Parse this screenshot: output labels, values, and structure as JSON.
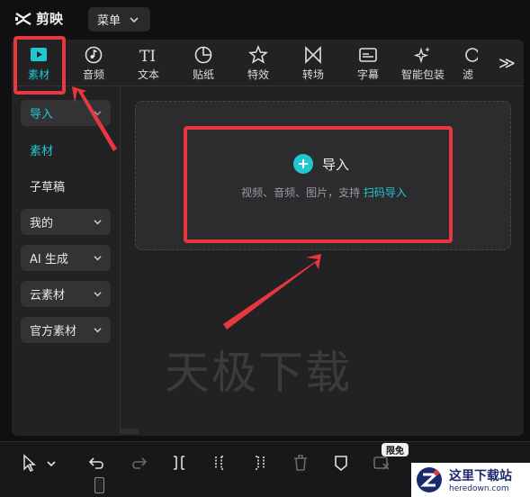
{
  "app": {
    "title": "剪映"
  },
  "menu": {
    "label": "菜单"
  },
  "toolbar": {
    "tabs": [
      {
        "label": "素材",
        "icon": "play-icon",
        "active": true
      },
      {
        "label": "音频",
        "icon": "music-note-icon"
      },
      {
        "label": "文本",
        "icon": "text-icon",
        "glyph": "TI"
      },
      {
        "label": "贴纸",
        "icon": "sticker-icon"
      },
      {
        "label": "特效",
        "icon": "star-icon"
      },
      {
        "label": "转场",
        "icon": "transition-icon"
      },
      {
        "label": "字幕",
        "icon": "caption-icon"
      },
      {
        "label": "智能包装",
        "icon": "sparkle-icon"
      },
      {
        "label": "滤",
        "icon": "filter-icon"
      }
    ],
    "more_glyph": "≫"
  },
  "sidebar": {
    "items": [
      {
        "label": "导入"
      },
      {
        "label": "素材"
      },
      {
        "label": "子草稿"
      },
      {
        "label": "我的"
      },
      {
        "label": "AI 生成"
      },
      {
        "label": "云素材"
      },
      {
        "label": "官方素材"
      }
    ]
  },
  "dropzone": {
    "import_label": "导入",
    "hint": "视频、音频、图片，支持 ",
    "link": "扫码导入"
  },
  "watermark": "天极下载",
  "bottombar": {
    "badge": "限免"
  },
  "site": {
    "name_cn": "这里下载站",
    "name_en": "heredown.com"
  },
  "colors": {
    "accent": "#22c8d0",
    "highlight": "#e8373e",
    "panel": "#222224"
  }
}
